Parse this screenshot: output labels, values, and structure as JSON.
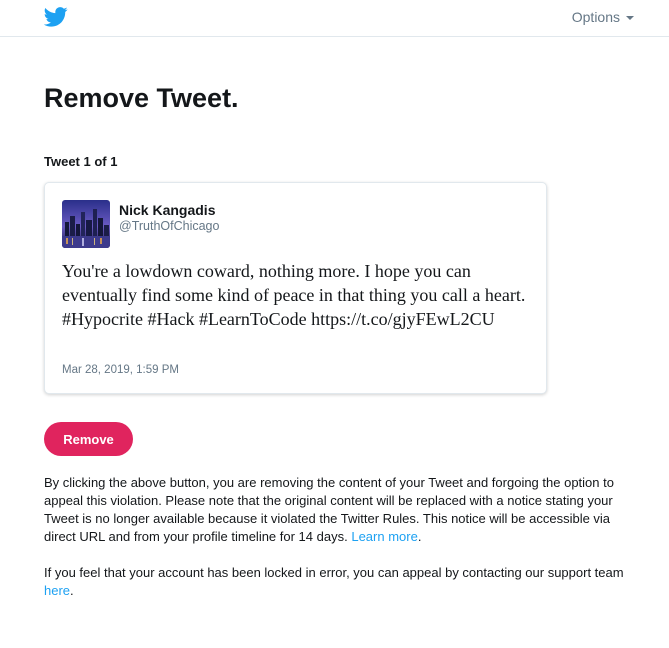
{
  "header": {
    "logo_icon": "twitter-bird-icon",
    "options_label": "Options",
    "brand_color": "#1da1f2"
  },
  "page": {
    "title": "Remove Tweet.",
    "counter": "Tweet 1 of 1"
  },
  "tweet": {
    "author_name": "Nick Kangadis",
    "author_handle": "@TruthOfChicago",
    "text": "You're a lowdown coward, nothing more. I hope you can eventually find some kind of peace in that thing you call a heart. #Hypocrite #Hack #LearnToCode https://t.co/gjyFEwL2CU",
    "timestamp": "Mar 28, 2019, 1:59 PM"
  },
  "actions": {
    "remove_label": "Remove",
    "remove_color": "#e0245e"
  },
  "info": {
    "paragraph1_text": "By clicking the above button, you are removing the content of your Tweet and forgoing the option to appeal this violation. Please note that the original content will be replaced with a notice stating your Tweet is no longer available because it violated the Twitter Rules. This notice will be accessible via direct URL and from your profile timeline for 14 days.",
    "learn_more_link": "Learn more",
    "paragraph2_text": "If you feel that your account has been locked in error, you can appeal by contacting our support team",
    "here_link": "here",
    "link_color": "#1da1f2"
  }
}
